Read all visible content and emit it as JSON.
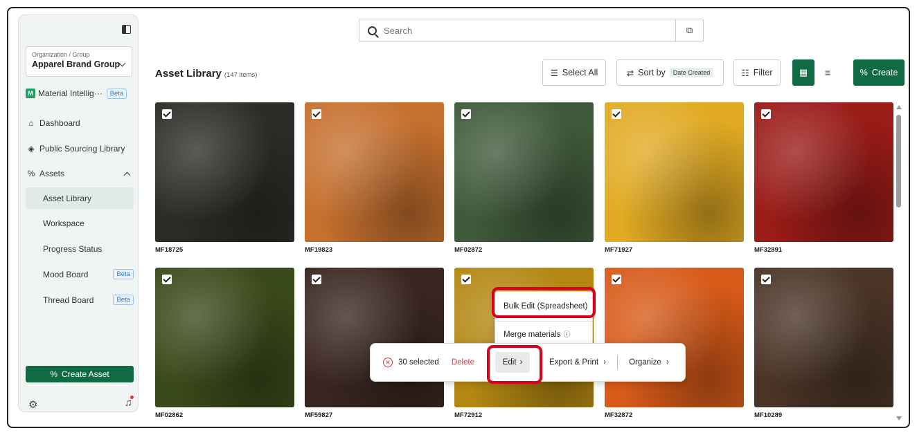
{
  "sidebar": {
    "org_label": "Organization / Group",
    "org_value": "Apparel Brand Group",
    "items": [
      {
        "label": "Material Intellig···",
        "badge": "Beta"
      },
      {
        "label": "Dashboard"
      },
      {
        "label": "Public Sourcing Library"
      },
      {
        "label": "Assets"
      }
    ],
    "sub_items": [
      {
        "label": "Asset Library",
        "active": true
      },
      {
        "label": "Workspace"
      },
      {
        "label": "Progress Status"
      },
      {
        "label": "Mood Board",
        "badge": "Beta"
      },
      {
        "label": "Thread Board",
        "badge": "Beta"
      }
    ],
    "create_asset": "Create Asset"
  },
  "search": {
    "placeholder": "Search"
  },
  "header": {
    "title": "Asset Library",
    "count": "(147 items)",
    "select_all": "Select All",
    "sort_by": "Sort by",
    "sort_value": "Date Created",
    "filter": "Filter",
    "create": "Create"
  },
  "assets": [
    {
      "code": "MF18725",
      "color": "#2c2c28"
    },
    {
      "code": "MF19823",
      "color": "#c6702e"
    },
    {
      "code": "MF02872",
      "color": "#3f5a3a"
    },
    {
      "code": "MF71927",
      "color": "#e1aa22"
    },
    {
      "code": "MF32891",
      "color": "#9a1b17"
    },
    {
      "code": "MF02862",
      "color": "#3b4a1a"
    },
    {
      "code": "MF59827",
      "color": "#3a2620"
    },
    {
      "code": "MF72912",
      "color": "#b38712"
    },
    {
      "code": "MF32872",
      "color": "#d85a18"
    },
    {
      "code": "MF10289",
      "color": "#4a3426"
    }
  ],
  "bulkbar": {
    "selected": "30 selected",
    "delete": "Delete",
    "edit": "Edit",
    "export": "Export & Print",
    "organize": "Organize"
  },
  "menu": {
    "bulk_edit": "Bulk Edit (Spreadsheet)",
    "merge": "Merge materials"
  }
}
